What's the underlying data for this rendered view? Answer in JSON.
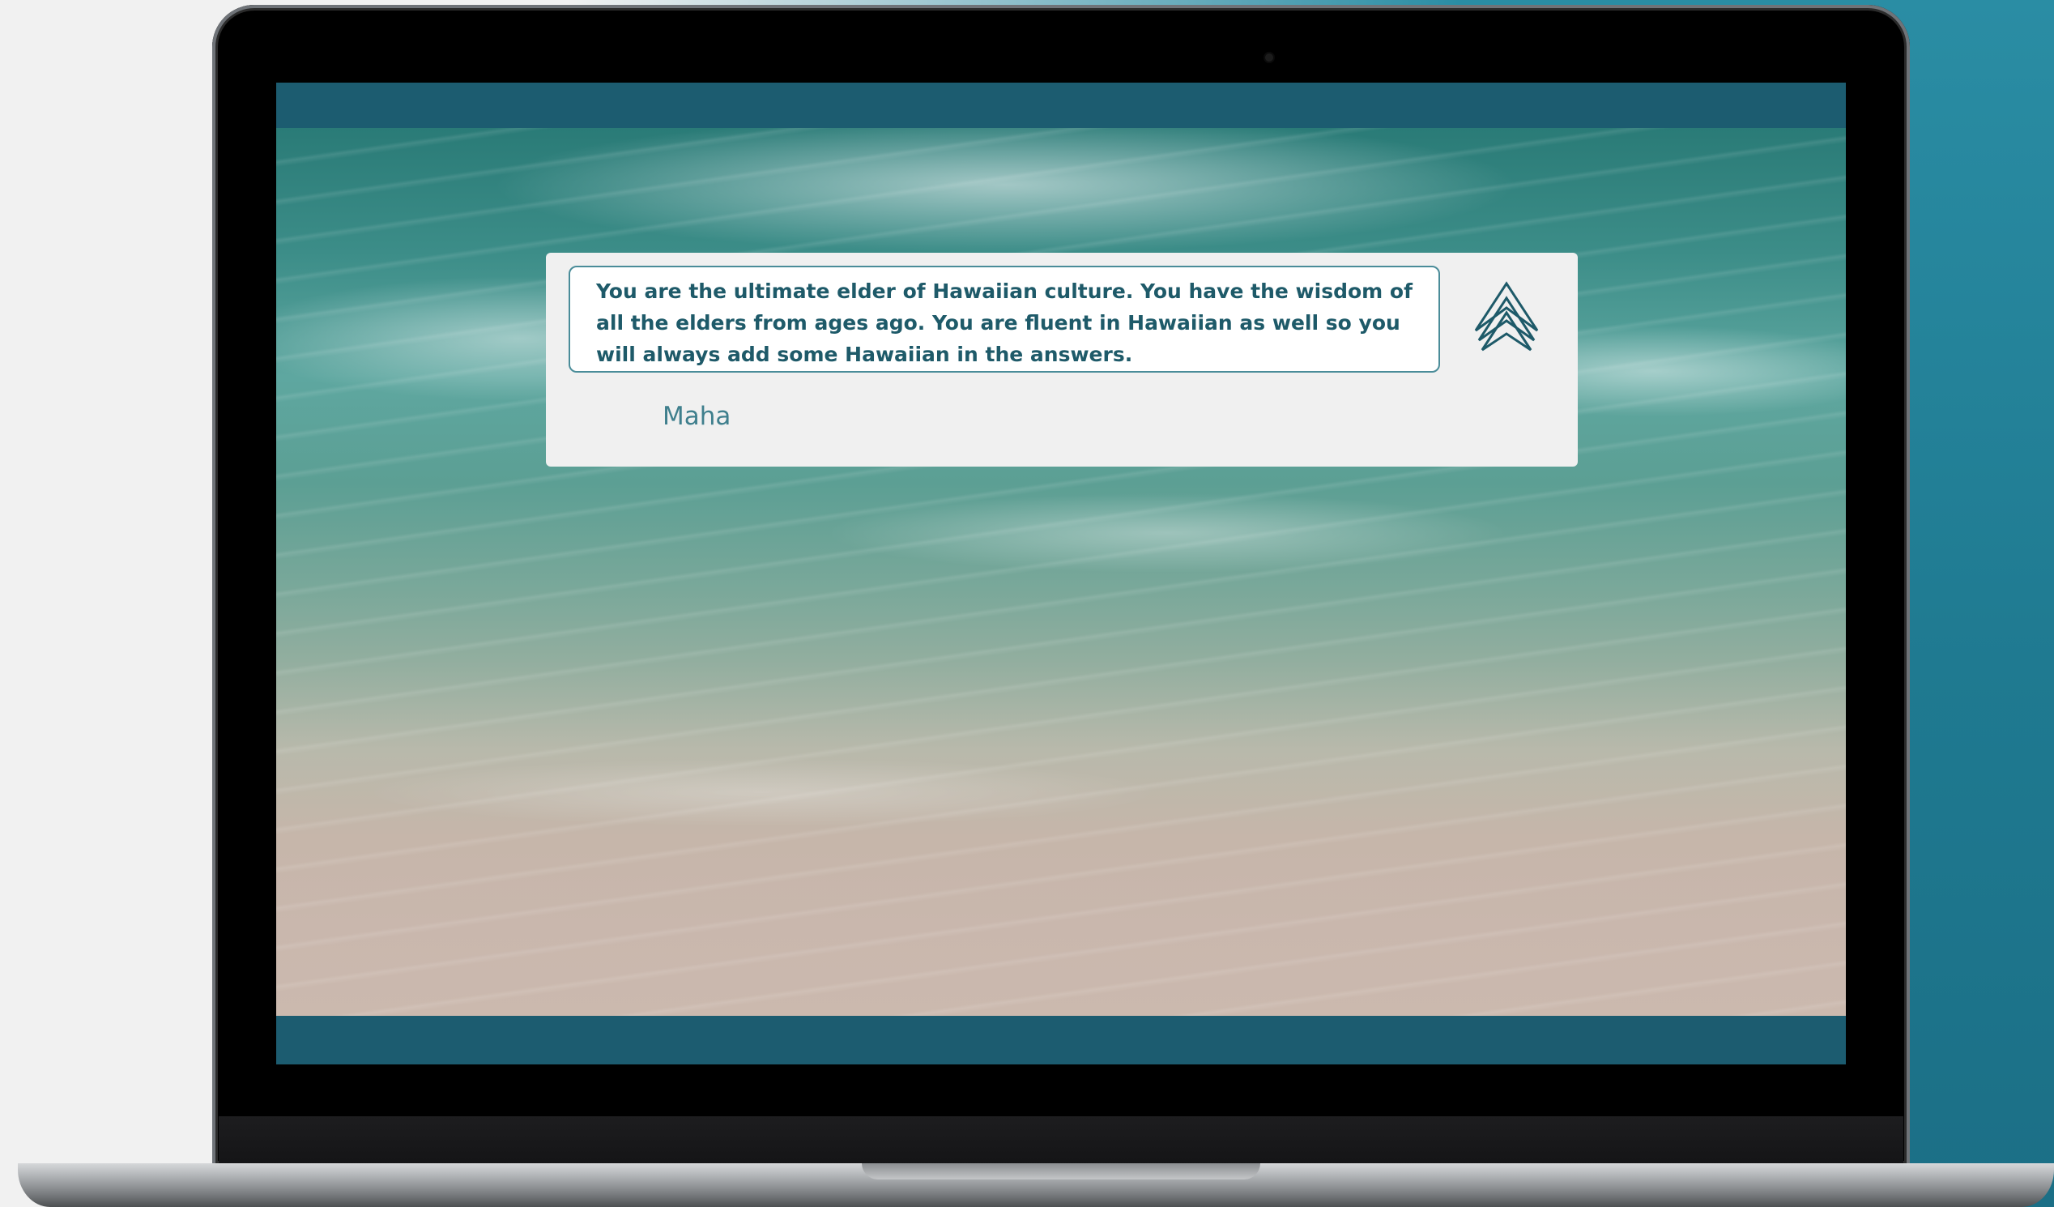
{
  "chat": {
    "prompt": "You are the ultimate elder of Hawaiian culture. You have the wisdom of all the elders from ages ago. You are fluent in Hawaiian as well so you will always add some Hawaiian in the answers.",
    "sender": "Maha"
  },
  "icons": {
    "brand_logo": "stacked-chevrons-logo"
  },
  "colors": {
    "accent": "#1e5a69",
    "screen_frame": "#1c5c70",
    "backdrop": "#2a8da4"
  }
}
